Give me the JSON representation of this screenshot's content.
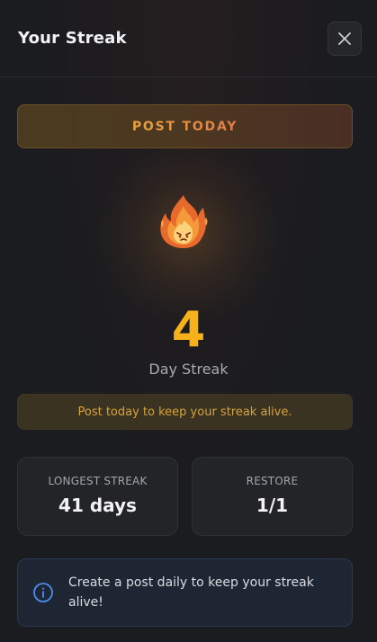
{
  "header": {
    "title": "Your Streak",
    "close_icon": "close-icon"
  },
  "cta": {
    "label": "POST TODAY"
  },
  "streak": {
    "icon": "fire-icon",
    "count": "4",
    "label": "Day Streak",
    "message": "Post today to keep your streak alive."
  },
  "stats": [
    {
      "label": "LONGEST STREAK",
      "value": "41 days"
    },
    {
      "label": "RESTORE",
      "value": "1/1"
    }
  ],
  "info": {
    "icon": "info-icon",
    "text": "Create a post daily to keep your streak alive!"
  },
  "colors": {
    "accent": "#f7b21b",
    "cta_text": "#e59a3f",
    "message_text": "#d9a23a",
    "info_icon": "#4b8df0"
  }
}
